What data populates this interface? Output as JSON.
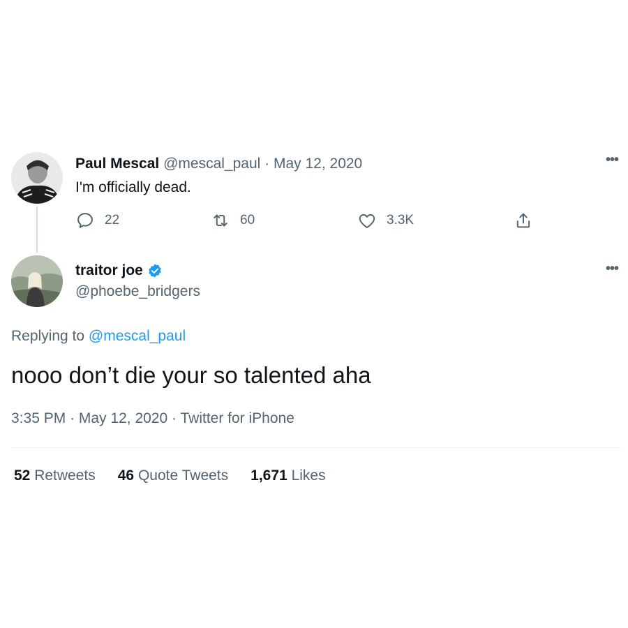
{
  "parent_tweet": {
    "display_name": "Paul Mescal",
    "handle": "@mescal_paul",
    "separator": "·",
    "date": "May 12, 2020",
    "text": "I'm officially dead.",
    "more_icon": "more-horizontal-icon",
    "actions": {
      "reply_count": "22",
      "retweet_count": "60",
      "like_count": "3.3K"
    }
  },
  "main_tweet": {
    "display_name": "traitor joe",
    "handle": "@phoebe_bridgers",
    "verified_icon": "verified-badge-icon",
    "replying_prefix": "Replying to",
    "replying_handle": "@mescal_paul",
    "text": "nooo don’t die your so talented aha",
    "time": "3:35 PM",
    "separator": "·",
    "date": "May 12, 2020",
    "source": "Twitter for iPhone"
  },
  "stats": {
    "retweets_count": "52",
    "retweets_label": "Retweets",
    "quote_count": "46",
    "quote_label": "Quote Tweets",
    "likes_count": "1,671",
    "likes_label": "Likes"
  },
  "colors": {
    "text": "#0f1419",
    "muted": "#536471",
    "link": "#1d9bf0",
    "verified": "#1d9bf0",
    "divider": "#eff3f4"
  }
}
